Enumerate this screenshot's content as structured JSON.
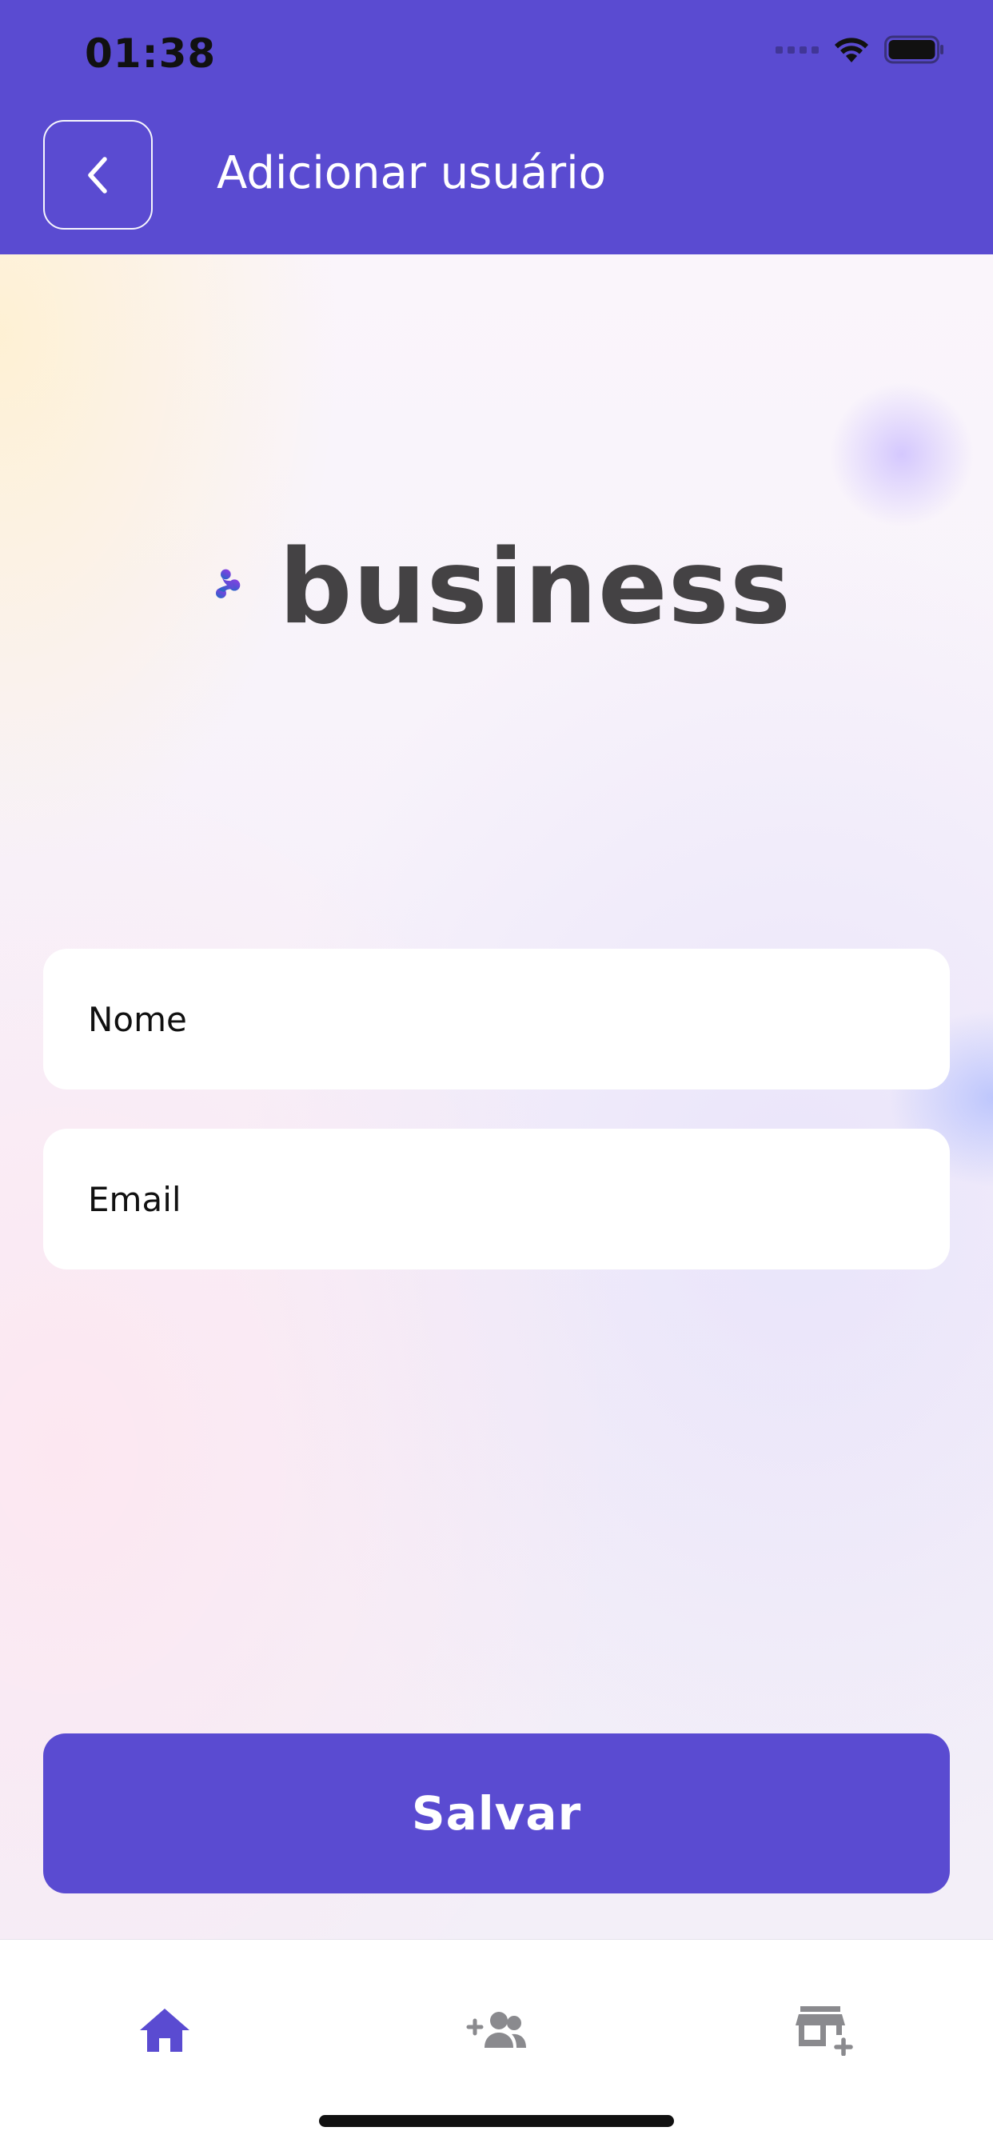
{
  "status_bar": {
    "time": "01:38",
    "icons": [
      "signal-icon",
      "wifi-icon",
      "battery-icon"
    ]
  },
  "header": {
    "back_icon": "chevron-left-icon",
    "title": "Adicionar usuário",
    "background_color": "#5a4bd1"
  },
  "logo": {
    "text": "business",
    "mark_colors": [
      "#8a3fe2",
      "#1f6bc4"
    ]
  },
  "form": {
    "name_placeholder": "Nome",
    "name_value": "",
    "email_placeholder": "Email",
    "email_value": ""
  },
  "actions": {
    "save_label": "Salvar",
    "accent_color": "#5a4bd1"
  },
  "tab_bar": {
    "items": [
      {
        "icon": "home-icon",
        "active": true
      },
      {
        "icon": "add-user-group-icon",
        "active": false
      },
      {
        "icon": "add-store-icon",
        "active": false
      }
    ],
    "active_color": "#5a4bd1",
    "inactive_color": "#8a8a8e"
  }
}
